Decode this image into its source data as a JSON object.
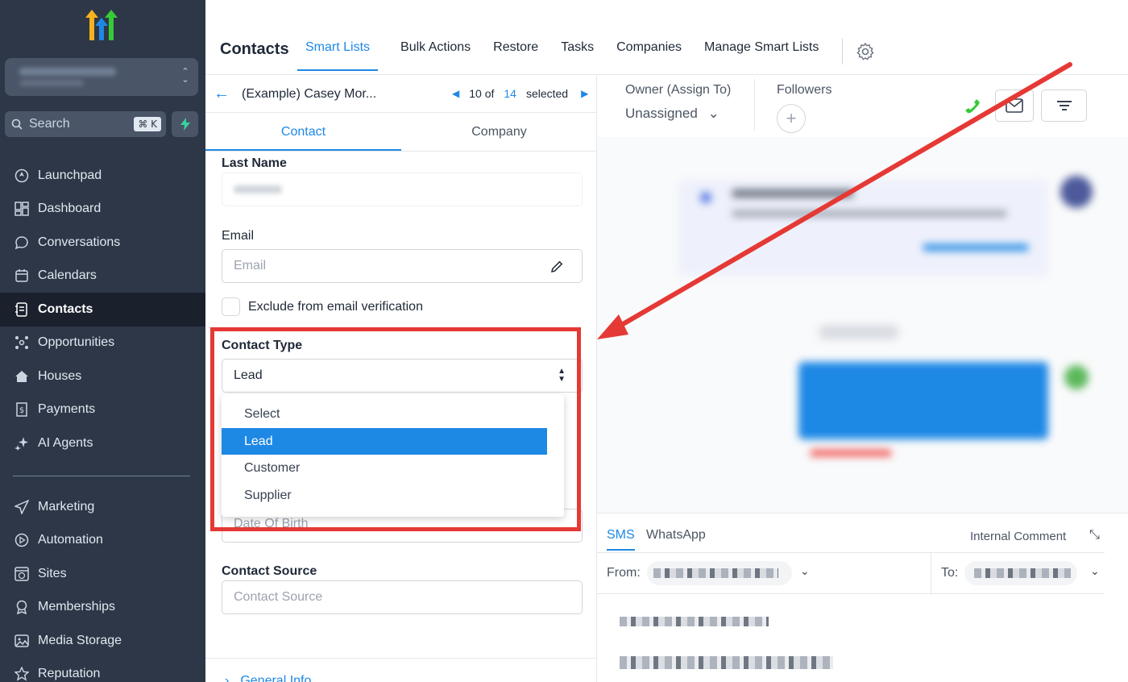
{
  "sidebar": {
    "search_placeholder": "Search",
    "search_shortcut": "⌘ K",
    "items": [
      {
        "label": "Launchpad"
      },
      {
        "label": "Dashboard"
      },
      {
        "label": "Conversations"
      },
      {
        "label": "Calendars"
      },
      {
        "label": "Contacts",
        "active": true
      },
      {
        "label": "Opportunities"
      },
      {
        "label": "Houses"
      },
      {
        "label": "Payments"
      },
      {
        "label": "AI Agents"
      }
    ],
    "items2": [
      {
        "label": "Marketing"
      },
      {
        "label": "Automation"
      },
      {
        "label": "Sites"
      },
      {
        "label": "Memberships"
      },
      {
        "label": "Media Storage"
      },
      {
        "label": "Reputation"
      }
    ]
  },
  "header": {
    "title": "Contacts",
    "tabs": [
      "Smart Lists",
      "Bulk Actions",
      "Restore",
      "Tasks",
      "Companies",
      "Manage Smart Lists"
    ]
  },
  "record": {
    "name": "(Example) Casey Mor...",
    "position": "10 of",
    "total": "14",
    "selected_label": "selected"
  },
  "form_tabs": [
    "Contact",
    "Company"
  ],
  "form": {
    "last_name_label": "Last Name",
    "email_label": "Email",
    "email_placeholder": "Email",
    "exclude_label": "Exclude from email verification",
    "contact_type_label": "Contact Type",
    "contact_type_value": "Lead",
    "contact_type_options": [
      "Select",
      "Lead",
      "Customer",
      "Supplier"
    ],
    "dob_placeholder": "Date Of Birth",
    "contact_source_label": "Contact Source",
    "contact_source_placeholder": "Contact Source",
    "general_info": "General Info"
  },
  "conversation": {
    "owner_label": "Owner (Assign To)",
    "owner_value": "Unassigned",
    "followers_label": "Followers",
    "composer_tabs": [
      "SMS",
      "WhatsApp"
    ],
    "internal_comment": "Internal Comment",
    "from_label": "From:",
    "to_label": "To:"
  },
  "colors": {
    "accent": "#1e88e5",
    "sidebar_bg": "#2d3748",
    "annotation_red": "#e53935"
  }
}
